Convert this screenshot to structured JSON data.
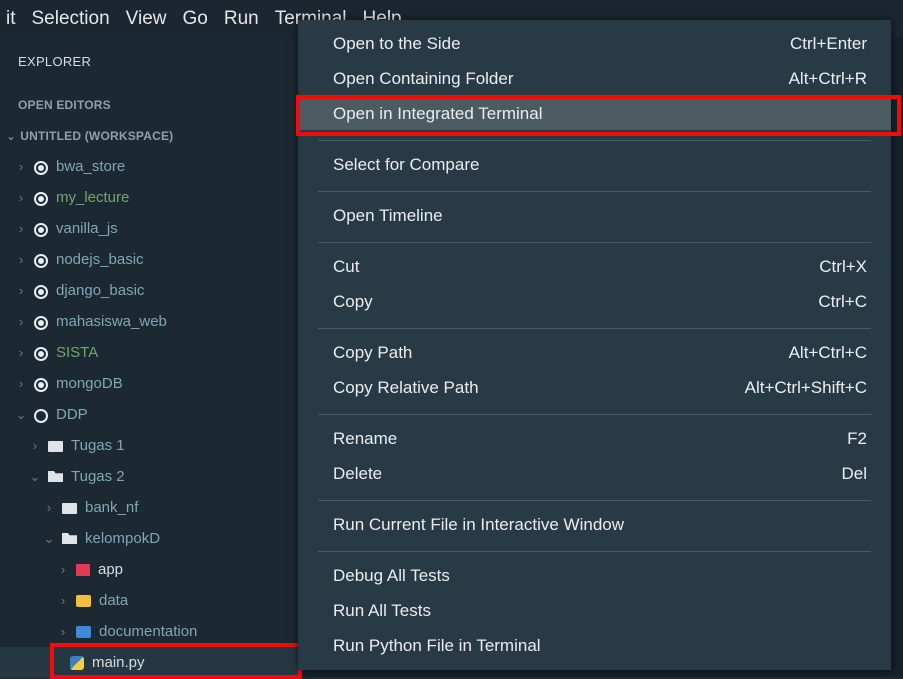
{
  "menubar": [
    "it",
    "Selection",
    "View",
    "Go",
    "Run",
    "Terminal",
    "Help"
  ],
  "sidebar": {
    "title": "EXPLORER",
    "open_editors": "OPEN EDITORS",
    "workspace": "UNTITLED (WORKSPACE)",
    "items": [
      {
        "label": "bwa_store",
        "kind": "repo"
      },
      {
        "label": "my_lecture",
        "kind": "repo"
      },
      {
        "label": "vanilla_js",
        "kind": "repo"
      },
      {
        "label": "nodejs_basic",
        "kind": "repo"
      },
      {
        "label": "django_basic",
        "kind": "repo"
      },
      {
        "label": "mahasiswa_web",
        "kind": "repo"
      },
      {
        "label": "SISTA",
        "kind": "repo"
      },
      {
        "label": "mongoDB",
        "kind": "repo"
      },
      {
        "label": "DDP",
        "kind": "repo-open"
      },
      {
        "label": "Tugas 1",
        "kind": "folder"
      },
      {
        "label": "Tugas 2",
        "kind": "folder-open"
      },
      {
        "label": "bank_nf",
        "kind": "folder"
      },
      {
        "label": "kelompokD",
        "kind": "folder-open"
      },
      {
        "label": "app",
        "kind": "app-folder"
      },
      {
        "label": "data",
        "kind": "data-folder"
      },
      {
        "label": "documentation",
        "kind": "doc-folder"
      },
      {
        "label": "main.py",
        "kind": "python-file"
      }
    ]
  },
  "context_menu": {
    "items": [
      {
        "label": "Open to the Side",
        "shortcut": "Ctrl+Enter"
      },
      {
        "label": "Open Containing Folder",
        "shortcut": "Alt+Ctrl+R"
      },
      {
        "label": "Open in Integrated Terminal",
        "shortcut": ""
      },
      {
        "label": "Select for Compare",
        "shortcut": ""
      },
      {
        "label": "Open Timeline",
        "shortcut": ""
      },
      {
        "label": "Cut",
        "shortcut": "Ctrl+X"
      },
      {
        "label": "Copy",
        "shortcut": "Ctrl+C"
      },
      {
        "label": "Copy Path",
        "shortcut": "Alt+Ctrl+C"
      },
      {
        "label": "Copy Relative Path",
        "shortcut": "Alt+Ctrl+Shift+C"
      },
      {
        "label": "Rename",
        "shortcut": "F2"
      },
      {
        "label": "Delete",
        "shortcut": "Del"
      },
      {
        "label": "Run Current File in Interactive Window",
        "shortcut": ""
      },
      {
        "label": "Debug All Tests",
        "shortcut": ""
      },
      {
        "label": "Run All Tests",
        "shortcut": ""
      },
      {
        "label": "Run Python File in Terminal",
        "shortcut": ""
      }
    ]
  },
  "colors": {
    "highlight_box": "#f20b0b",
    "menu_bg": "#283a46",
    "sidebar_bg": "#1c2832"
  }
}
